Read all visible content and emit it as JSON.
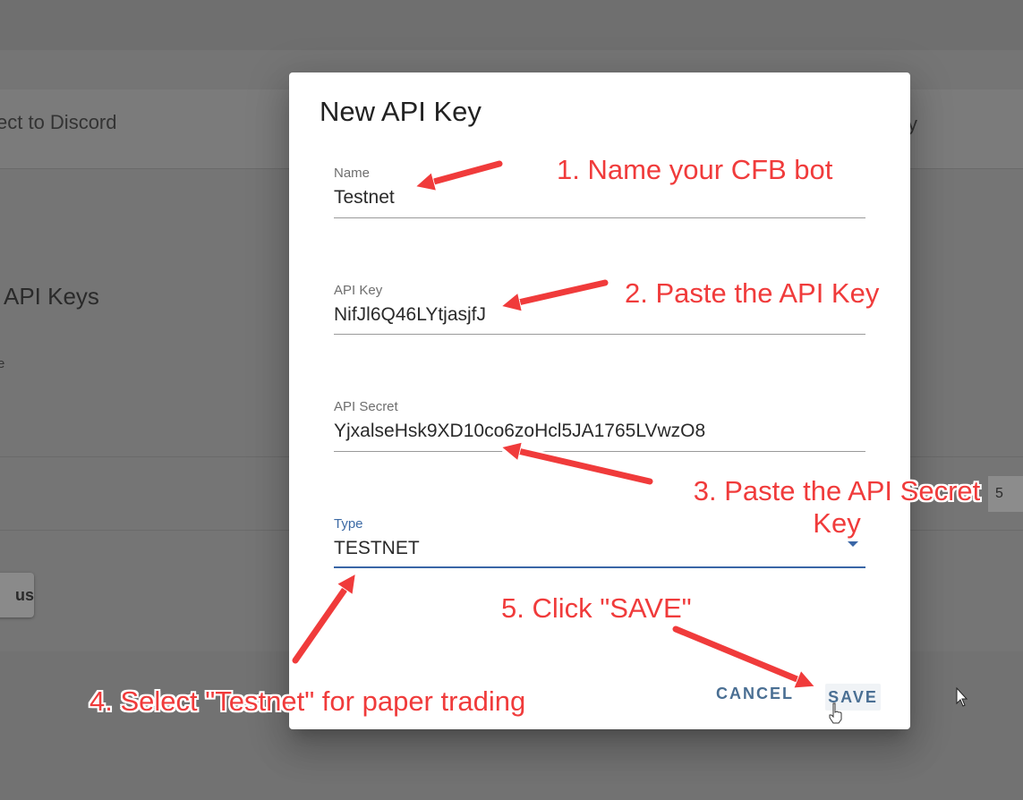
{
  "background": {
    "discord_text": "ect to Discord",
    "api_keys_title": "API Keys",
    "small_text": "e",
    "right_text": "y",
    "status_button_label": "us",
    "right_input_value": "5"
  },
  "dialog": {
    "title": "New API Key",
    "fields": {
      "name": {
        "label": "Name",
        "value": "Testnet"
      },
      "api_key": {
        "label": "API Key",
        "value": "NifJl6Q46LYtjasjfJ"
      },
      "api_secret": {
        "label": "API Secret",
        "value": "YjxalseHsk9XD10co6zoHcl5JA1765LVwzO8"
      },
      "type": {
        "label": "Type",
        "value": "TESTNET"
      }
    },
    "actions": {
      "cancel_label": "CANCEL",
      "save_label": "SAVE"
    }
  },
  "annotations": {
    "step1": "1. Name your CFB bot",
    "step2": "2. Paste the API Key",
    "step3_line1": "3. Paste the API Secret",
    "step3_line2": "Key",
    "step4": "4. Select \"Testnet\" for paper trading",
    "step5": "5. Click \"SAVE\"",
    "arrow_color": "#f03b3b"
  }
}
